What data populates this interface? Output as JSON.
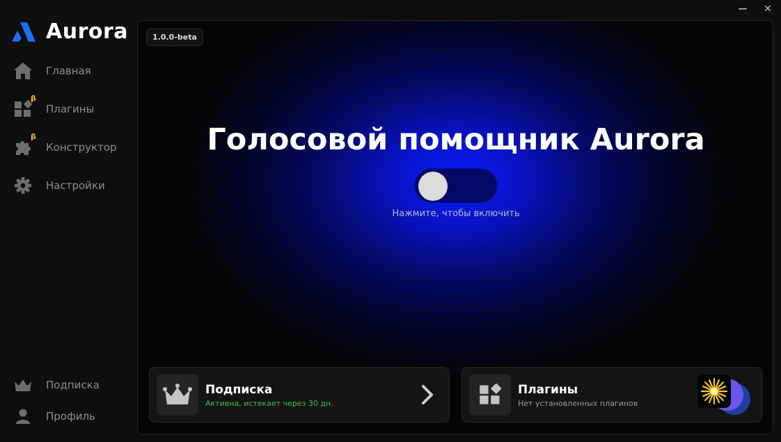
{
  "app": {
    "name": "Aurora"
  },
  "window": {
    "minimize_icon": "minimize-icon",
    "close_icon": "close-icon",
    "close_label": "✕"
  },
  "sidebar": {
    "items": [
      {
        "label": "Главная",
        "icon": "home-icon",
        "beta": ""
      },
      {
        "label": "Плагины",
        "icon": "plugins-icon",
        "beta": "β"
      },
      {
        "label": "Конструктор",
        "icon": "puzzle-icon",
        "beta": "β"
      },
      {
        "label": "Настройки",
        "icon": "gear-icon",
        "beta": ""
      }
    ],
    "bottom": [
      {
        "label": "Подписка",
        "icon": "crown-icon"
      },
      {
        "label": "Профиль",
        "icon": "user-icon"
      }
    ]
  },
  "main": {
    "version": "1.0.0-beta",
    "title": "Голосовой помощник Aurora",
    "toggle": {
      "state": "off"
    },
    "hint": "Нажмите, чтобы включить"
  },
  "cards": {
    "subscription": {
      "title": "Подписка",
      "subtitle": "Активна, истекает через 30 дн.",
      "icon": "crown-icon"
    },
    "plugins": {
      "title": "Плагины",
      "subtitle": "Нет установленных плагинов",
      "icon": "plugins-icon"
    }
  },
  "colors": {
    "accent_blue": "#0a1cff",
    "toggle_track": "#020a66",
    "beta_badge": "#f5b83c",
    "status_active": "#37c14a",
    "background": "#0e0e0e"
  }
}
